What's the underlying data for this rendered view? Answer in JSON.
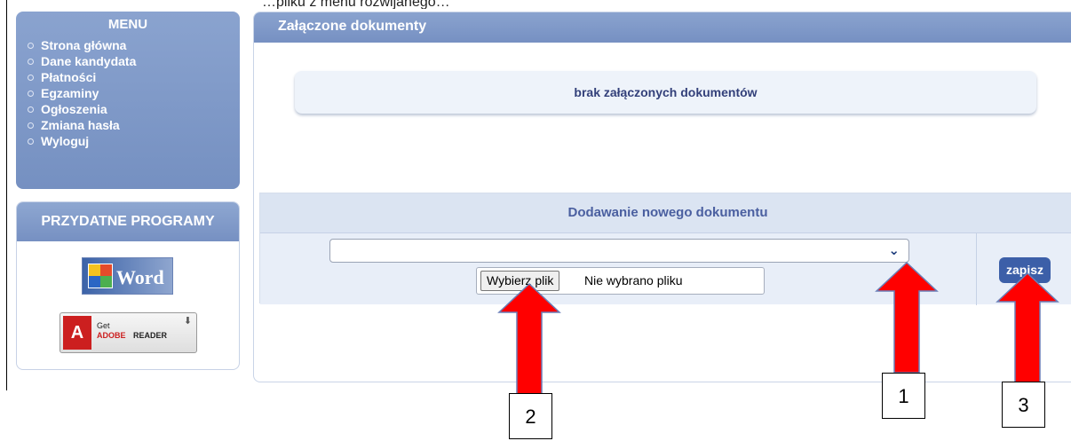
{
  "top_text": "…pliku z menu rozwijanego…",
  "sidebar": {
    "menu_title": "MENU",
    "menu_items": [
      "Strona główna",
      "Dane kandydata",
      "Płatności",
      "Egzaminy",
      "Ogłoszenia",
      "Zmiana hasła",
      "Wyloguj"
    ],
    "tools_title": "PRZYDATNE PROGRAMY",
    "adobe": {
      "get": "Get",
      "adobe": "ADOBE",
      "reader": "READER"
    }
  },
  "panel": {
    "title": "Załączone dokumenty",
    "empty_info": "brak załączonych dokumentów"
  },
  "add_document": {
    "header": "Dodawanie nowego dokumentu",
    "select_value": "",
    "file_button": "Wybierz plik",
    "file_status": "Nie wybrano pliku",
    "save_button": "zapisz"
  },
  "annotations": {
    "labels": [
      "1",
      "2",
      "3"
    ],
    "arrow_color": "#ff0000"
  }
}
